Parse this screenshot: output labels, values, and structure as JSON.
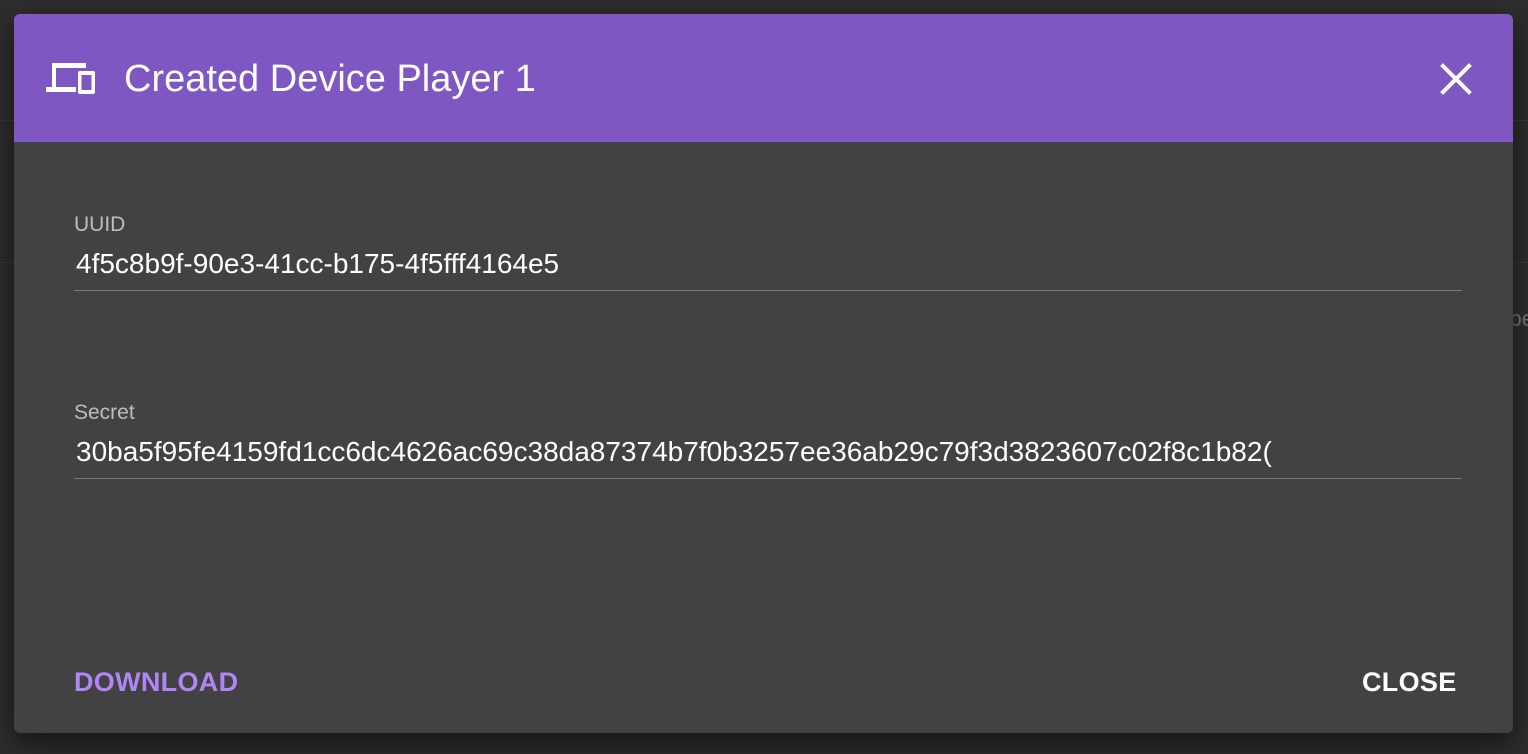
{
  "dialog": {
    "title": "Created Device Player 1",
    "header_icon": "devices-icon",
    "close_icon": "close-icon",
    "header_color": "#7e57c2"
  },
  "fields": {
    "uuid": {
      "label": "UUID",
      "value": "4f5c8b9f-90e3-41cc-b175-4f5fff4164e5"
    },
    "secret": {
      "label": "Secret",
      "value": "30ba5f95fe4159fd1cc6dc4626ac69c38da87374b7f0b3257ee36ab29c79f3d3823607c02f8c1b82("
    }
  },
  "actions": {
    "download_label": "DOWNLOAD",
    "close_label": "CLOSE",
    "accent_color": "#b085f5"
  },
  "background": {
    "peek_text": "pe"
  }
}
